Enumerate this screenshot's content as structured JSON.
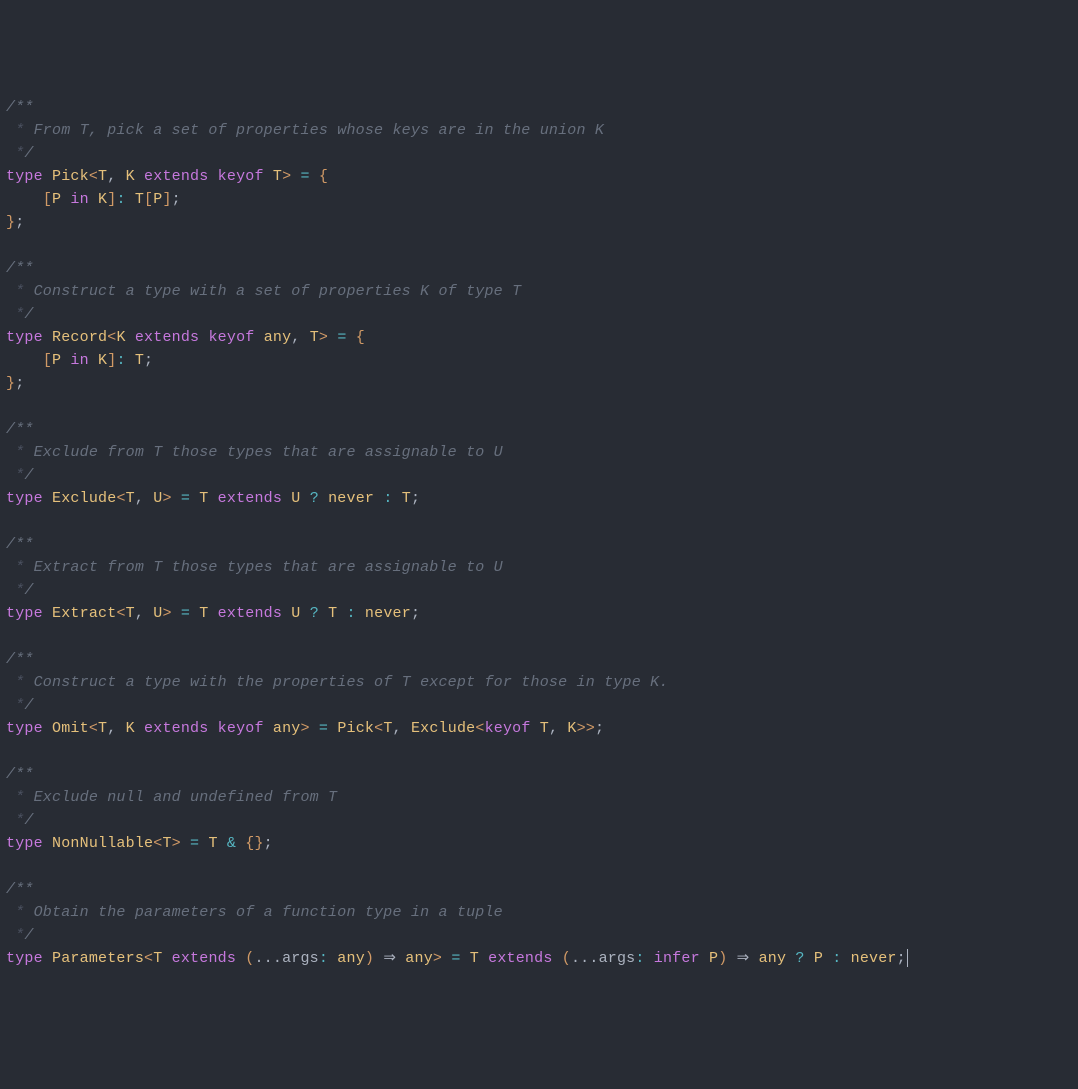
{
  "lines": [
    {
      "type": "comment-open",
      "text": "/**"
    },
    {
      "type": "comment-body",
      "text": " * From T, pick a set of properties whose keys are in the union K"
    },
    {
      "type": "comment-close",
      "text": " */"
    },
    {
      "type": "code",
      "tokens": [
        [
          "kw",
          "type"
        ],
        [
          "pu",
          " "
        ],
        [
          "nm",
          "Pick"
        ],
        [
          "br",
          "<"
        ],
        [
          "nm",
          "T"
        ],
        [
          "pu",
          ", "
        ],
        [
          "nm",
          "K"
        ],
        [
          "pu",
          " "
        ],
        [
          "kw",
          "extends"
        ],
        [
          "pu",
          " "
        ],
        [
          "kw",
          "keyof"
        ],
        [
          "pu",
          " "
        ],
        [
          "nm",
          "T"
        ],
        [
          "br",
          ">"
        ],
        [
          "pu",
          " "
        ],
        [
          "op",
          "="
        ],
        [
          "pu",
          " "
        ],
        [
          "br",
          "{"
        ]
      ]
    },
    {
      "type": "code",
      "tokens": [
        [
          "pu",
          "    "
        ],
        [
          "br",
          "["
        ],
        [
          "nm",
          "P"
        ],
        [
          "pu",
          " "
        ],
        [
          "kw",
          "in"
        ],
        [
          "pu",
          " "
        ],
        [
          "nm",
          "K"
        ],
        [
          "br",
          "]"
        ],
        [
          "op",
          ":"
        ],
        [
          "pu",
          " "
        ],
        [
          "nm",
          "T"
        ],
        [
          "br",
          "["
        ],
        [
          "nm",
          "P"
        ],
        [
          "br",
          "]"
        ],
        [
          "pu",
          ";"
        ]
      ]
    },
    {
      "type": "code",
      "tokens": [
        [
          "br",
          "}"
        ],
        [
          "pu",
          ";"
        ]
      ]
    },
    {
      "type": "blank"
    },
    {
      "type": "comment-open",
      "text": "/**"
    },
    {
      "type": "comment-body",
      "text": " * Construct a type with a set of properties K of type T"
    },
    {
      "type": "comment-close",
      "text": " */"
    },
    {
      "type": "code",
      "tokens": [
        [
          "kw",
          "type"
        ],
        [
          "pu",
          " "
        ],
        [
          "nm",
          "Record"
        ],
        [
          "br",
          "<"
        ],
        [
          "nm",
          "K"
        ],
        [
          "pu",
          " "
        ],
        [
          "kw",
          "extends"
        ],
        [
          "pu",
          " "
        ],
        [
          "kw",
          "keyof"
        ],
        [
          "pu",
          " "
        ],
        [
          "nm",
          "any"
        ],
        [
          "pu",
          ", "
        ],
        [
          "nm",
          "T"
        ],
        [
          "br",
          ">"
        ],
        [
          "pu",
          " "
        ],
        [
          "op",
          "="
        ],
        [
          "pu",
          " "
        ],
        [
          "br",
          "{"
        ]
      ]
    },
    {
      "type": "code",
      "tokens": [
        [
          "pu",
          "    "
        ],
        [
          "br",
          "["
        ],
        [
          "nm",
          "P"
        ],
        [
          "pu",
          " "
        ],
        [
          "kw",
          "in"
        ],
        [
          "pu",
          " "
        ],
        [
          "nm",
          "K"
        ],
        [
          "br",
          "]"
        ],
        [
          "op",
          ":"
        ],
        [
          "pu",
          " "
        ],
        [
          "nm",
          "T"
        ],
        [
          "pu",
          ";"
        ]
      ]
    },
    {
      "type": "code",
      "tokens": [
        [
          "br",
          "}"
        ],
        [
          "pu",
          ";"
        ]
      ]
    },
    {
      "type": "blank"
    },
    {
      "type": "comment-open",
      "text": "/**"
    },
    {
      "type": "comment-body",
      "text": " * Exclude from T those types that are assignable to U"
    },
    {
      "type": "comment-close",
      "text": " */"
    },
    {
      "type": "code",
      "tokens": [
        [
          "kw",
          "type"
        ],
        [
          "pu",
          " "
        ],
        [
          "nm",
          "Exclude"
        ],
        [
          "br",
          "<"
        ],
        [
          "nm",
          "T"
        ],
        [
          "pu",
          ", "
        ],
        [
          "nm",
          "U"
        ],
        [
          "br",
          ">"
        ],
        [
          "pu",
          " "
        ],
        [
          "op",
          "="
        ],
        [
          "pu",
          " "
        ],
        [
          "nm",
          "T"
        ],
        [
          "pu",
          " "
        ],
        [
          "kw",
          "extends"
        ],
        [
          "pu",
          " "
        ],
        [
          "nm",
          "U"
        ],
        [
          "pu",
          " "
        ],
        [
          "op",
          "?"
        ],
        [
          "pu",
          " "
        ],
        [
          "nm",
          "never"
        ],
        [
          "pu",
          " "
        ],
        [
          "op",
          ":"
        ],
        [
          "pu",
          " "
        ],
        [
          "nm",
          "T"
        ],
        [
          "pu",
          ";"
        ]
      ]
    },
    {
      "type": "blank"
    },
    {
      "type": "comment-open",
      "text": "/**"
    },
    {
      "type": "comment-body",
      "text": " * Extract from T those types that are assignable to U"
    },
    {
      "type": "comment-close",
      "text": " */"
    },
    {
      "type": "code",
      "tokens": [
        [
          "kw",
          "type"
        ],
        [
          "pu",
          " "
        ],
        [
          "nm",
          "Extract"
        ],
        [
          "br",
          "<"
        ],
        [
          "nm",
          "T"
        ],
        [
          "pu",
          ", "
        ],
        [
          "nm",
          "U"
        ],
        [
          "br",
          ">"
        ],
        [
          "pu",
          " "
        ],
        [
          "op",
          "="
        ],
        [
          "pu",
          " "
        ],
        [
          "nm",
          "T"
        ],
        [
          "pu",
          " "
        ],
        [
          "kw",
          "extends"
        ],
        [
          "pu",
          " "
        ],
        [
          "nm",
          "U"
        ],
        [
          "pu",
          " "
        ],
        [
          "op",
          "?"
        ],
        [
          "pu",
          " "
        ],
        [
          "nm",
          "T"
        ],
        [
          "pu",
          " "
        ],
        [
          "op",
          ":"
        ],
        [
          "pu",
          " "
        ],
        [
          "nm",
          "never"
        ],
        [
          "pu",
          ";"
        ]
      ]
    },
    {
      "type": "blank"
    },
    {
      "type": "comment-open",
      "text": "/**"
    },
    {
      "type": "comment-body",
      "text": " * Construct a type with the properties of T except for those in type K."
    },
    {
      "type": "comment-close",
      "text": " */"
    },
    {
      "type": "code",
      "tokens": [
        [
          "kw",
          "type"
        ],
        [
          "pu",
          " "
        ],
        [
          "nm",
          "Omit"
        ],
        [
          "br",
          "<"
        ],
        [
          "nm",
          "T"
        ],
        [
          "pu",
          ", "
        ],
        [
          "nm",
          "K"
        ],
        [
          "pu",
          " "
        ],
        [
          "kw",
          "extends"
        ],
        [
          "pu",
          " "
        ],
        [
          "kw",
          "keyof"
        ],
        [
          "pu",
          " "
        ],
        [
          "nm",
          "any"
        ],
        [
          "br",
          ">"
        ],
        [
          "pu",
          " "
        ],
        [
          "op",
          "="
        ],
        [
          "pu",
          " "
        ],
        [
          "nm",
          "Pick"
        ],
        [
          "br",
          "<"
        ],
        [
          "nm",
          "T"
        ],
        [
          "pu",
          ", "
        ],
        [
          "nm",
          "Exclude"
        ],
        [
          "br",
          "<"
        ],
        [
          "kw",
          "keyof"
        ],
        [
          "pu",
          " "
        ],
        [
          "nm",
          "T"
        ],
        [
          "pu",
          ", "
        ],
        [
          "nm",
          "K"
        ],
        [
          "br",
          ">>"
        ],
        [
          "pu",
          ";"
        ]
      ]
    },
    {
      "type": "blank"
    },
    {
      "type": "comment-open",
      "text": "/**"
    },
    {
      "type": "comment-body",
      "text": " * Exclude null and undefined from T"
    },
    {
      "type": "comment-close",
      "text": " */"
    },
    {
      "type": "code",
      "tokens": [
        [
          "kw",
          "type"
        ],
        [
          "pu",
          " "
        ],
        [
          "nm",
          "NonNullable"
        ],
        [
          "br",
          "<"
        ],
        [
          "nm",
          "T"
        ],
        [
          "br",
          ">"
        ],
        [
          "pu",
          " "
        ],
        [
          "op",
          "="
        ],
        [
          "pu",
          " "
        ],
        [
          "nm",
          "T"
        ],
        [
          "pu",
          " "
        ],
        [
          "op",
          "&"
        ],
        [
          "pu",
          " "
        ],
        [
          "br",
          "{}"
        ],
        [
          "pu",
          ";"
        ]
      ]
    },
    {
      "type": "blank"
    },
    {
      "type": "comment-open",
      "text": "/**"
    },
    {
      "type": "comment-body",
      "text": " * Obtain the parameters of a function type in a tuple"
    },
    {
      "type": "comment-close",
      "text": " */"
    },
    {
      "type": "code",
      "cursor": true,
      "tokens": [
        [
          "kw",
          "type"
        ],
        [
          "pu",
          " "
        ],
        [
          "nm",
          "Parameters"
        ],
        [
          "br",
          "<"
        ],
        [
          "nm",
          "T"
        ],
        [
          "pu",
          " "
        ],
        [
          "kw",
          "extends"
        ],
        [
          "pu",
          " "
        ],
        [
          "br",
          "("
        ],
        [
          "pu",
          "..."
        ],
        [
          "id",
          "args"
        ],
        [
          "op",
          ":"
        ],
        [
          "pu",
          " "
        ],
        [
          "nm",
          "any"
        ],
        [
          "br",
          ")"
        ],
        [
          "pu",
          " "
        ],
        [
          "ar",
          "⇒"
        ],
        [
          "pu",
          " "
        ],
        [
          "nm",
          "any"
        ],
        [
          "br",
          ">"
        ],
        [
          "pu",
          " "
        ],
        [
          "op",
          "="
        ],
        [
          "pu",
          " "
        ],
        [
          "nm",
          "T"
        ],
        [
          "pu",
          " "
        ],
        [
          "kw",
          "extends"
        ],
        [
          "pu",
          " "
        ],
        [
          "br",
          "("
        ],
        [
          "pu",
          "..."
        ],
        [
          "id",
          "args"
        ],
        [
          "op",
          ":"
        ],
        [
          "pu",
          " "
        ],
        [
          "kw",
          "infer"
        ],
        [
          "pu",
          " "
        ],
        [
          "nm",
          "P"
        ],
        [
          "br",
          ")"
        ],
        [
          "pu",
          " "
        ],
        [
          "ar",
          "⇒"
        ],
        [
          "pu",
          " "
        ],
        [
          "nm",
          "any"
        ],
        [
          "pu",
          " "
        ],
        [
          "op",
          "?"
        ],
        [
          "pu",
          " "
        ],
        [
          "nm",
          "P"
        ],
        [
          "pu",
          " "
        ],
        [
          "op",
          ":"
        ],
        [
          "pu",
          " "
        ],
        [
          "nm",
          "never"
        ],
        [
          "pu",
          ";"
        ]
      ]
    }
  ]
}
